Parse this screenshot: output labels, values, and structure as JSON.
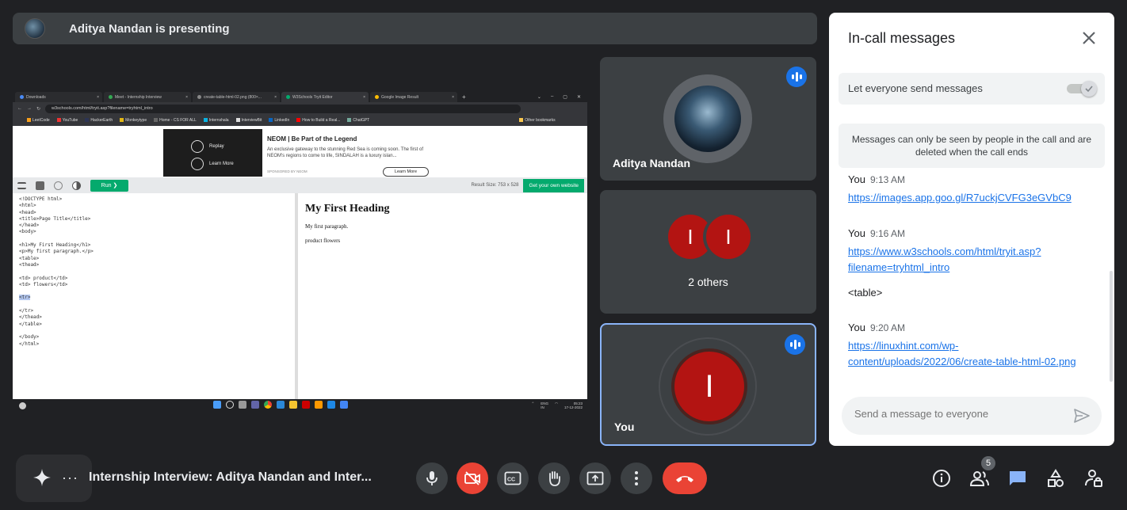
{
  "presenting": {
    "text": "Aditya Nandan is presenting"
  },
  "shared_screen": {
    "tabs": [
      "Downloads",
      "Meet - Internship Interview",
      "create-table-html-02.png (800×...",
      "W3Schools Tryit Editor",
      "Google Image Result"
    ],
    "url": "w3schools.com/html/tryit.asp?filename=tryhtml_intro",
    "bookmarks": [
      "LeetCode",
      "YouTube",
      "HackerEarth",
      "Monkeytype",
      "Home - CS FOR ALL",
      "Internshala",
      "InterviewBit",
      "LinkedIn",
      "How to Build a Real...",
      "ChatGPT",
      "Other bookmarks"
    ],
    "ad": {
      "replay": "Replay",
      "learn_more_small": "Learn More",
      "title": "NEOM | Be Part of the Legend",
      "desc": "An exclusive gateway to the stunning Red Sea is coming soon. The first of NEOM's regions to come to life, SINDALAH is a luxury islan...",
      "sponsored": "SPONSORED BY NEOM",
      "button": "Learn More"
    },
    "toolbar": {
      "run": "Run ❯",
      "result_size": "Result Size: 753 x 528",
      "get_site": "Get your own website"
    },
    "code_lines": [
      "<!DOCTYPE html>",
      "<html>",
      "<head>",
      "<title>Page Title</title>",
      "</head>",
      "<body>",
      "",
      "<h1>My First Heading</h1>",
      "<p>My first paragraph.</p>",
      "<table>",
      "<thead>",
      "",
      "<td> product</td>",
      "<td> flowers</td>",
      "",
      "<tr>",
      "",
      "</tr>",
      "</thead>",
      "</table>",
      "",
      "</body>",
      "</html>"
    ],
    "result": {
      "heading": "My First Heading",
      "paragraph": "My first paragraph.",
      "cells": "product flowers"
    },
    "taskbar": {
      "lang": "ENG\nIN",
      "time": "05:23",
      "date": "17-12-2022"
    }
  },
  "tiles": {
    "presenter": {
      "name": "Aditya Nandan"
    },
    "others": {
      "initial1": "I",
      "initial2": "I",
      "label": "2 others"
    },
    "self": {
      "initial": "I",
      "name": "You"
    }
  },
  "chat": {
    "title": "In-call messages",
    "toggle_label": "Let everyone send messages",
    "toggle_on": true,
    "notice": "Messages can only be seen by people in the call and are deleted when the call ends",
    "messages": [
      {
        "sender": "You",
        "time": "9:13 AM",
        "link": "https://images.app.goo.gl/R7uckjCVFG3eGVbC9"
      },
      {
        "sender": "You",
        "time": "9:16 AM",
        "link": "https://www.w3schools.com/html/tryit.asp?filename=tryhtml_intro",
        "link_line1": "https://www.w3schools.com/html/tryit.asp?",
        "link_line2": "filename=tryhtml_intro",
        "text": "<table>"
      },
      {
        "sender": "You",
        "time": "9:20 AM",
        "link": "https://linuxhint.com/wp-content/uploads/2022/06/create-table-html-02.png",
        "link_line1": "https://linuxhint.com/wp-",
        "link_line2": "content/uploads/2022/06/create-table-html-02.png"
      }
    ],
    "input_placeholder": "Send a message to everyone"
  },
  "bottom": {
    "meeting_name": "Internship Interview: Aditya Nandan and Inter...",
    "participant_count": "5"
  },
  "colors": {
    "hangup": "#ea4335",
    "accent": "#1a73e8",
    "avatar_red": "#b31412"
  }
}
